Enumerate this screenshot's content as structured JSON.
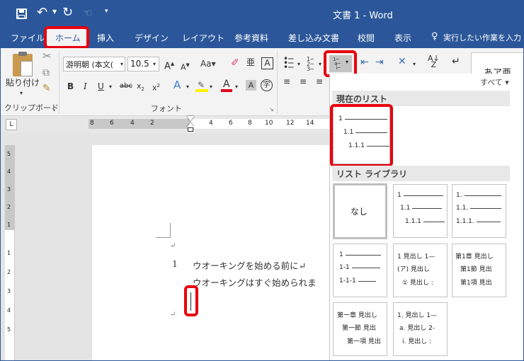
{
  "titlebar": {
    "doc_title": "文書 1 - Word"
  },
  "tabs": [
    "ファイル",
    "ホーム",
    "挿入",
    "デザイン",
    "レイアウト",
    "参考資料",
    "差し込み文書",
    "校閲",
    "表示"
  ],
  "tellme": "実行したい作業を入力",
  "ribbon": {
    "paste_label": "貼り付け",
    "font_name": "游明朝 (本文(",
    "font_size": "10.5",
    "font_group_label": "フォント",
    "clipboard_group_label": "クリップボード",
    "style_preview": "あア亜"
  },
  "ruler": {
    "left": [
      "8",
      "6",
      "4",
      "2"
    ],
    "right": [
      "4",
      "6",
      "8",
      "10",
      "12",
      "14"
    ]
  },
  "vruler": [
    "5",
    "4",
    "3",
    "2",
    "1",
    "1",
    "2",
    "3",
    "4",
    "5"
  ],
  "document": {
    "para_mark": "↵",
    "line1_num": "1",
    "line1": "ウオーキングを始める前に↵",
    "line2": "ウオーキングはすぐ始められま",
    "end_mark": "↵"
  },
  "panel": {
    "filter": "すべて",
    "current_header": "現在のリスト",
    "library_header": "リスト ライブラリ",
    "none_label": "なし",
    "current_lines": [
      "1",
      "1.1",
      "1.1.1"
    ],
    "cells": [
      [
        "1",
        "1.1",
        "1.1.1"
      ],
      [
        "1.",
        "1.1.",
        "1.1.1."
      ],
      [
        "1",
        "1-1",
        "1-1-1"
      ],
      [
        "1 見出し 1—",
        "(ア) 見出し",
        "① 見出し :"
      ],
      [
        "第1章 見出し",
        "第1節 見出",
        "第1項 見出"
      ],
      [
        "第一章 見出し",
        "第一節 見出",
        "第一項 見出"
      ],
      [
        "1. 見出し 1—",
        "a. 見出し 2-",
        "i. 見出し :"
      ]
    ]
  }
}
